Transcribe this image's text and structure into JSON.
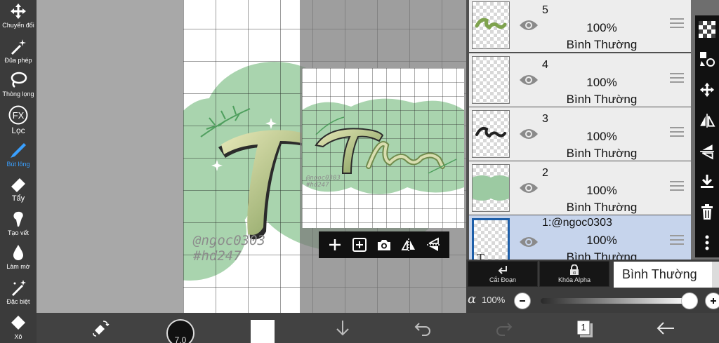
{
  "left_toolbar": {
    "tools": [
      {
        "label": "Chuyển đổi",
        "icon": "move-arrows-icon"
      },
      {
        "label": "Đũa phép",
        "icon": "magic-wand-icon"
      },
      {
        "label": "Thòng lọng",
        "icon": "lasso-icon"
      },
      {
        "label": "Lọc",
        "icon": "fx-filter-icon"
      },
      {
        "label": "Bút lông",
        "icon": "brush-icon",
        "active": true
      },
      {
        "label": "Tẩy",
        "icon": "eraser-icon"
      },
      {
        "label": "Tạo vết",
        "icon": "smudge-icon"
      },
      {
        "label": "Làm mờ",
        "icon": "blur-drop-icon"
      },
      {
        "label": "Đặc biệt",
        "icon": "special-brush-icon"
      },
      {
        "label": "Xô",
        "icon": "bucket-icon"
      }
    ]
  },
  "canvas": {
    "watermark_line1": "@ngoc0303",
    "watermark_line2": "#hd247",
    "reference": {
      "watermark_line1": "@ngoc0303",
      "watermark_line2": "#hd247",
      "toolbar": [
        "plus-icon",
        "add-image-icon",
        "camera-icon",
        "flip-horizontal-icon",
        "flip-vertical-icon"
      ]
    }
  },
  "layers": [
    {
      "number": "5",
      "opacity": "100%",
      "blend": "Bình Thường",
      "thumb": "green-text"
    },
    {
      "number": "4",
      "opacity": "100%",
      "blend": "Bình Thường",
      "thumb": "empty"
    },
    {
      "number": "3",
      "opacity": "100%",
      "blend": "Bình Thường",
      "thumb": "dark-text"
    },
    {
      "number": "2",
      "opacity": "100%",
      "blend": "Bình Thường",
      "thumb": "green-shape"
    },
    {
      "number": "1:@ngoc0303",
      "opacity": "100%",
      "blend": "Bình Thường",
      "thumb": "text-layer",
      "selected": true
    }
  ],
  "layer_controls": {
    "clipping_label": "Cắt Đoạn",
    "alpha_lock_label": "Khóa Alpha",
    "blend_mode": "Bình Thường",
    "alpha_symbol": "α",
    "opacity_value": "100%",
    "opacity_fraction": 1.0
  },
  "bottom_bar": {
    "brush_size": "7.0",
    "color": "#ffffff",
    "layer_count": "1"
  },
  "colors": {
    "accent_blue": "#3aa0ff",
    "selected_layer": "#c6d4ec",
    "art_green": "#a9d4ae"
  }
}
